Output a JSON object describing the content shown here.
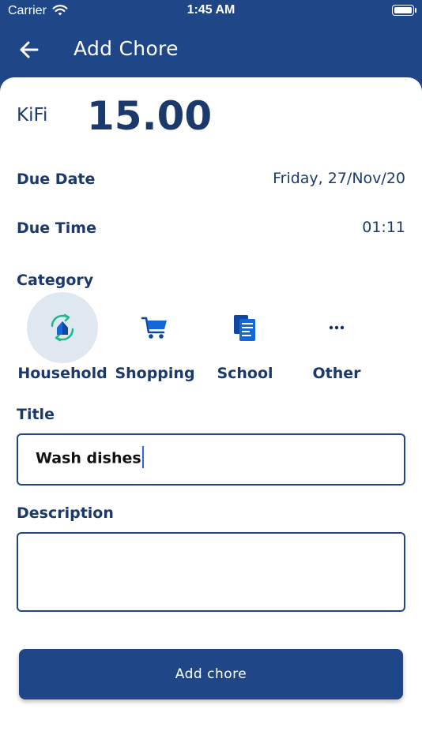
{
  "status_bar": {
    "carrier": "Carrier",
    "time": "1:45 AM"
  },
  "nav": {
    "title": "Add Chore",
    "back_icon": "arrow-left-icon"
  },
  "amount": {
    "currency": "KiFi",
    "value": "15.00"
  },
  "due_date": {
    "label": "Due Date",
    "value": "Friday, 27/Nov/20"
  },
  "due_time": {
    "label": "Due Time",
    "value": "01:11"
  },
  "category": {
    "label": "Category",
    "selected": "Household",
    "items": [
      {
        "label": "Household",
        "icon": "household-icon"
      },
      {
        "label": "Shopping",
        "icon": "shopping-cart-icon"
      },
      {
        "label": "School",
        "icon": "school-document-icon"
      },
      {
        "label": "Other",
        "icon": "more-dots-icon"
      }
    ]
  },
  "title_field": {
    "label": "Title",
    "value": "Wash dishes"
  },
  "description_field": {
    "label": "Description",
    "value": ""
  },
  "submit": {
    "label": "Add chore"
  },
  "colors": {
    "primary": "#1f4686",
    "text": "#1b3a6b",
    "accent_green": "#1fb88a",
    "icon_blue": "#1566d6",
    "selected_bg": "#dfe7f1",
    "caret": "#2f64e0"
  }
}
